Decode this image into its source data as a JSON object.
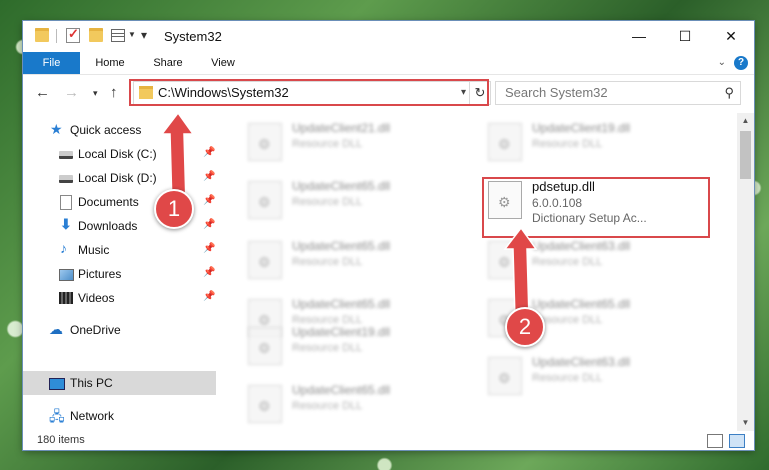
{
  "window": {
    "title": "System32",
    "controls": {
      "minimize": "—",
      "maximize": "☐",
      "close": "✕"
    }
  },
  "ribbon": {
    "tabs": [
      "File",
      "Home",
      "Share",
      "View"
    ],
    "help": "?"
  },
  "address": {
    "path": "C:\\Windows\\System32",
    "search_placeholder": "Search System32"
  },
  "sidebar": {
    "items": [
      {
        "label": "Quick access",
        "icon": "star-icon"
      },
      {
        "label": "Local Disk (C:)",
        "icon": "disk-icon",
        "pinned": true
      },
      {
        "label": "Local Disk (D:)",
        "icon": "disk-icon",
        "pinned": true
      },
      {
        "label": "Documents",
        "icon": "documents-icon",
        "pinned": true
      },
      {
        "label": "Downloads",
        "icon": "download-icon",
        "pinned": true
      },
      {
        "label": "Music",
        "icon": "music-icon",
        "pinned": true
      },
      {
        "label": "Pictures",
        "icon": "pictures-icon",
        "pinned": true
      },
      {
        "label": "Videos",
        "icon": "videos-icon",
        "pinned": true
      },
      {
        "label": "OneDrive",
        "icon": "cloud-icon"
      },
      {
        "label": "This PC",
        "icon": "computer-icon",
        "selected": true
      },
      {
        "label": "Network",
        "icon": "network-icon"
      }
    ]
  },
  "files": {
    "left": [
      {
        "name": "UpdateClient21.dll",
        "type": "Resource DLL"
      },
      {
        "name": "UpdateClient65.dll",
        "type": "Resource DLL"
      },
      {
        "name": "UpdateClient65.dll",
        "type": "Resource DLL"
      },
      {
        "name": "UpdateClient65.dll",
        "type": "Resource DLL"
      },
      {
        "name": "UpdateClient19.dll",
        "type": "Resource DLL"
      },
      {
        "name": "UpdateClient65.dll",
        "type": "Resource DLL"
      }
    ],
    "right": [
      {
        "name": "UpdateClient19.dll",
        "type": "Resource DLL"
      },
      {
        "name": "pdsetup.dll",
        "type": "6.0.0.108",
        "desc": "Dictionary Setup Ac...",
        "highlighted": true
      },
      {
        "name": "UpdateClient63.dll",
        "type": "Resource DLL"
      },
      {
        "name": "UpdateClient65.dll",
        "type": "Resource DLL"
      },
      {
        "name": "UpdateClient63.dll",
        "type": "Resource DLL"
      }
    ]
  },
  "status": {
    "items_count": "180 items"
  },
  "annotations": {
    "step1": "1",
    "step2": "2",
    "color": "#e04848"
  }
}
